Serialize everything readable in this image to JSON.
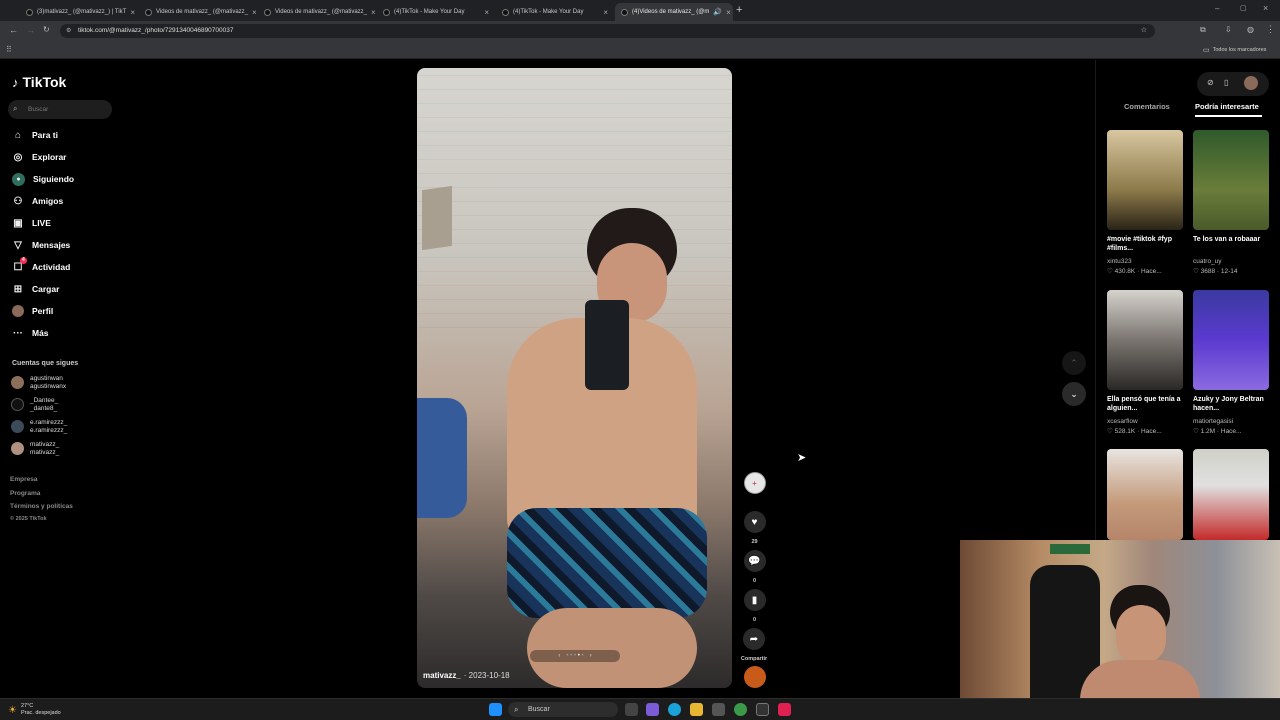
{
  "tabs": [
    {
      "label": "(3)mativazz_ (@mativazz_) | TikT",
      "active": false
    },
    {
      "label": "Videos de mativazz_ (@mativazz_",
      "active": false
    },
    {
      "label": "Videos de mativazz_ (@mativazz_",
      "active": false
    },
    {
      "label": "(4)TikTok - Make Your Day",
      "active": false
    },
    {
      "label": "(4)TikTok - Make Your Day",
      "active": false
    },
    {
      "label": "(4)Videos de mativazz_ (@m",
      "active": true
    }
  ],
  "address": {
    "url": "tiktok.com/@mativazz_/photo/7291340046890700037"
  },
  "bookmarks": {
    "all_label": "Todos los marcadores"
  },
  "sidebar": {
    "logo": "TikTok",
    "search_placeholder": "Buscar",
    "items": [
      {
        "label": "Para ti",
        "icon": "home-icon"
      },
      {
        "label": "Explorar",
        "icon": "compass-icon"
      },
      {
        "label": "Siguiendo",
        "icon": "following-icon"
      },
      {
        "label": "Amigos",
        "icon": "friends-icon"
      },
      {
        "label": "LIVE",
        "icon": "live-icon"
      },
      {
        "label": "Mensajes",
        "icon": "messages-icon"
      },
      {
        "label": "Actividad",
        "icon": "activity-icon",
        "badge": "4"
      },
      {
        "label": "Cargar",
        "icon": "upload-icon"
      },
      {
        "label": "Perfil",
        "icon": "profile-icon"
      },
      {
        "label": "Más",
        "icon": "more-icon"
      }
    ],
    "following_heading": "Cuentas que sigues",
    "following": [
      {
        "name": "agustinwan",
        "handle": "agustinwanx"
      },
      {
        "name": "_Dantee_",
        "handle": "_dante8_"
      },
      {
        "name": "e.ramirezzz_",
        "handle": "e.ramirezzz_"
      },
      {
        "name": "mativazz_",
        "handle": "mativazz_"
      }
    ],
    "footer": [
      "Empresa",
      "Programa",
      "Términos y políticas",
      "© 2025 TikTok"
    ]
  },
  "video": {
    "author": "mativazz_",
    "date": "· 2023-10-18",
    "likes": "29",
    "comments": "0",
    "saves": "0",
    "share_label": "Compartir"
  },
  "right_panel": {
    "tab_comments": "Comentarios",
    "tab_suggestions": "Podría interesarte",
    "cards": [
      {
        "title": "#movie #tiktok #fyp #films...",
        "author": "xintu323",
        "likes": "430.8K",
        "time": "· Hace..."
      },
      {
        "title": "Te los van a robaaar",
        "author": "cuatro_uy",
        "likes": "3688",
        "time": "· 12-14"
      },
      {
        "title": "Ella pensó que tenía a alguien...",
        "author": "xcesarflow",
        "likes": "528.1K",
        "time": "· Hace..."
      },
      {
        "title": "Azuky y Jony Beltran hacen...",
        "author": "matiortegasisi",
        "likes": "1.2M",
        "time": "· Hace..."
      },
      {
        "title": "",
        "author": "",
        "likes": "",
        "time": ""
      },
      {
        "title": "",
        "author": "",
        "likes": "",
        "time": ""
      }
    ]
  },
  "taskbar": {
    "weather_temp": "27°C",
    "weather_desc": "Prac. despejado",
    "search_label": "Buscar"
  }
}
